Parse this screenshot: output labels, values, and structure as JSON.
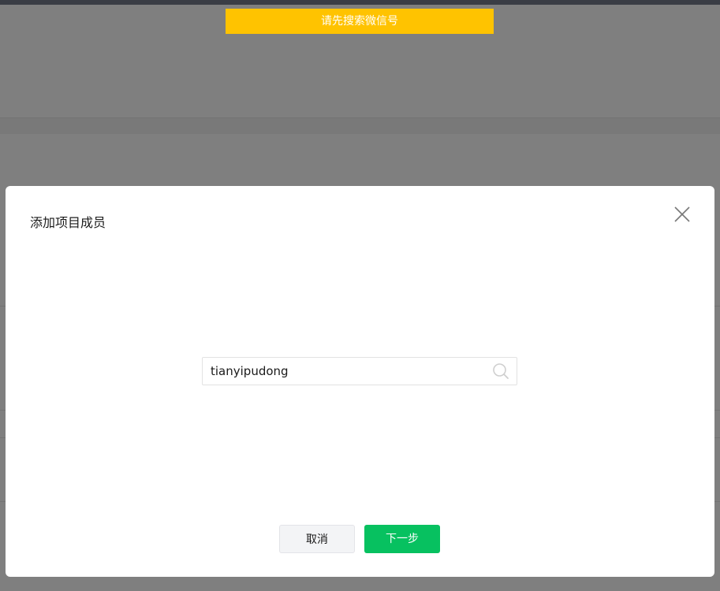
{
  "toast": {
    "message": "请先搜索微信号",
    "color": "#ffc300"
  },
  "dialog": {
    "title": "添加项目成员",
    "close_icon": "close-icon",
    "search": {
      "value": "tianyipudong",
      "icon": "search-icon"
    },
    "buttons": {
      "cancel_label": "取消",
      "next_label": "下一步",
      "next_color": "#07c160"
    }
  }
}
